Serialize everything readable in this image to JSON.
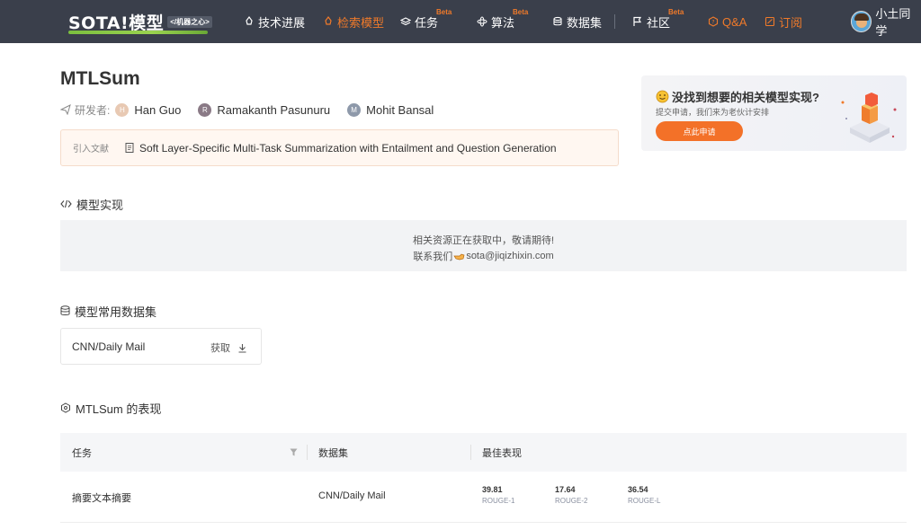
{
  "header": {
    "logo_text": "SOTA!模型",
    "logo_tag": "</机器之心>",
    "nav": [
      {
        "label": "技术进展",
        "icon": "rocket-icon"
      },
      {
        "label": "检索模型",
        "icon": "rocket-icon",
        "active": true
      },
      {
        "label": "任务",
        "icon": "layers-icon",
        "badge": "Beta"
      },
      {
        "label": "算法",
        "icon": "atom-icon",
        "badge": "Beta"
      },
      {
        "label": "数据集",
        "icon": "database-icon"
      },
      {
        "label": "社区",
        "icon": "flag-icon",
        "badge": "Beta"
      },
      {
        "label": "Q&A",
        "icon": "question-icon"
      },
      {
        "label": "订阅",
        "icon": "subscribe-icon"
      }
    ],
    "user_name": "小土同学"
  },
  "model": {
    "title": "MTLSum",
    "authors_label": "研发者:",
    "authors": [
      {
        "initial": "H",
        "name": "Han Guo",
        "color": "#e8c9b3"
      },
      {
        "initial": "R",
        "name": "Ramakanth Pasunuru",
        "color": "#8a7a86"
      },
      {
        "initial": "M",
        "name": "Mohit Bansal",
        "color": "#8e99aa"
      }
    ],
    "citation_label": "引入文献",
    "citation": "Soft Layer-Specific Multi-Task Summarization with Entailment and Question Generation"
  },
  "promo": {
    "title": "没找到想要的相关模型实现?",
    "subtitle": "提交申请，我们来为老伙计安排",
    "button": "点此申请"
  },
  "implementation": {
    "title": "模型实现",
    "line1": "相关资源正在获取中，敬请期待!",
    "line2_prefix": "联系我们",
    "email": "sota@jiqizhixin.com"
  },
  "datasets": {
    "title": "模型常用数据集",
    "items": [
      {
        "name": "CNN/Daily Mail",
        "action": "获取"
      }
    ]
  },
  "performance": {
    "title": "MTLSum 的表现",
    "columns": [
      "任务",
      "数据集",
      "最佳表现"
    ],
    "rows": [
      {
        "task": "摘要文本摘要",
        "dataset": "CNN/Daily Mail",
        "metrics": [
          {
            "value": "39.81",
            "name": "ROUGE-1"
          },
          {
            "value": "17.64",
            "name": "ROUGE-2"
          },
          {
            "value": "36.54",
            "name": "ROUGE-L"
          }
        ]
      }
    ]
  },
  "colors": {
    "accent": "#f07a2a",
    "header_bg": "#3a3f4b"
  }
}
